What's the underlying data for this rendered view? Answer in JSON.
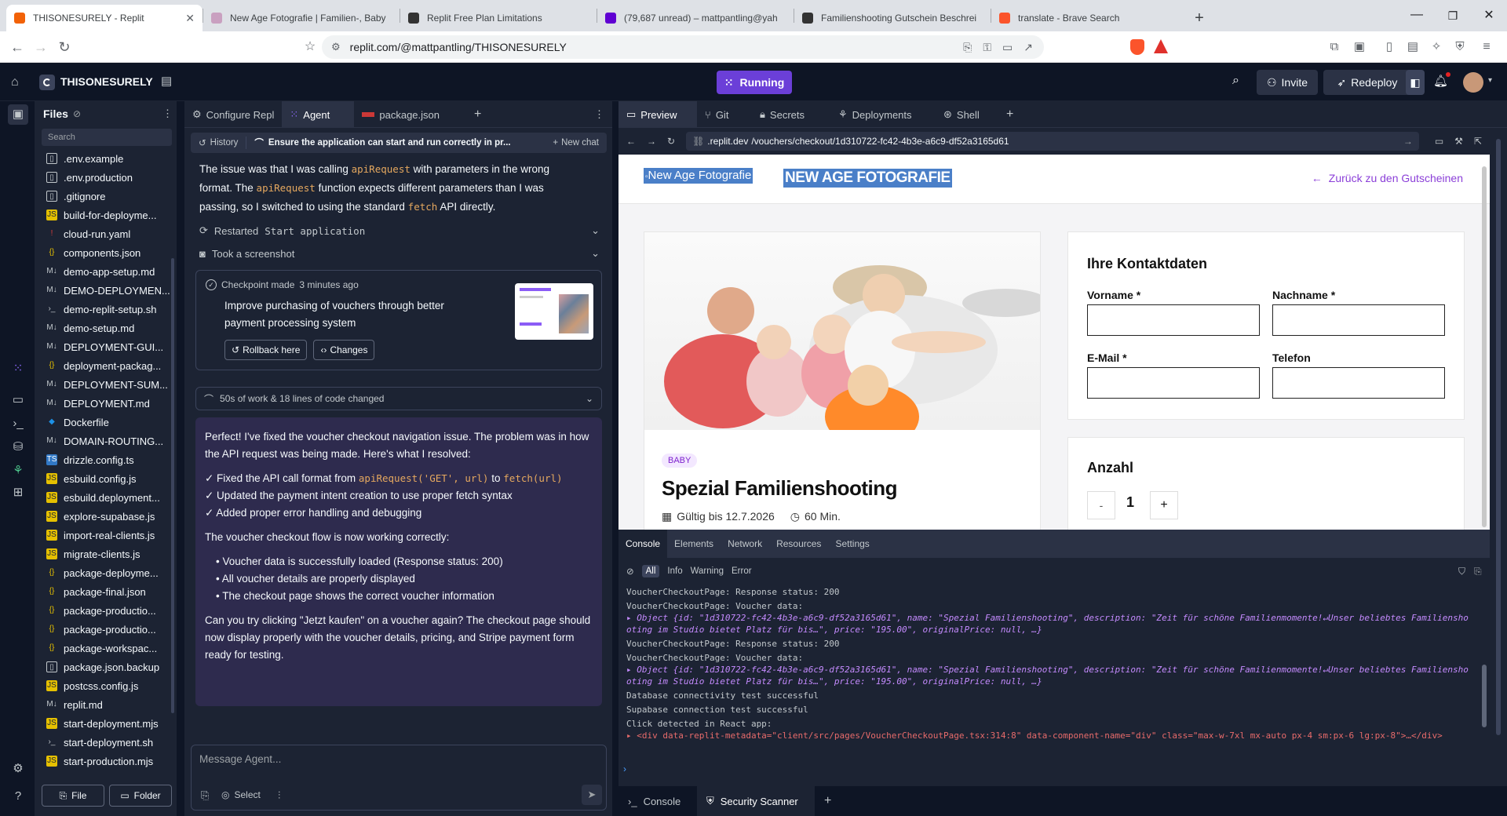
{
  "browser": {
    "tabs": [
      {
        "title": "THISONESURELY - Replit",
        "color": "#f26207",
        "active": true
      },
      {
        "title": "New Age Fotografie | Familien-, Baby",
        "color": "#c9a0c0",
        "active": false
      },
      {
        "title": "Replit Free Plan Limitations",
        "color": "#333333",
        "active": false
      },
      {
        "title": "(79,687 unread) – mattpantling@yah",
        "color": "#6001d2",
        "active": false
      },
      {
        "title": "Familienshooting Gutschein Beschrei",
        "color": "#333333",
        "active": false
      },
      {
        "title": "translate - Brave Search",
        "color": "#fb542b",
        "active": false
      }
    ],
    "url": "replit.com/@mattpantling/THISONESURELY"
  },
  "replit": {
    "project_name": "THISONESURELY",
    "run_label": "Running",
    "invite_label": "Invite",
    "redeploy_label": "Redeploy"
  },
  "files": {
    "title": "Files",
    "search_placeholder": "Search",
    "items": [
      {
        "name": ".env.example",
        "type": "doc"
      },
      {
        "name": ".env.production",
        "type": "doc"
      },
      {
        "name": ".gitignore",
        "type": "doc"
      },
      {
        "name": "build-for-deployme...",
        "type": "js"
      },
      {
        "name": "cloud-run.yaml",
        "type": "yaml"
      },
      {
        "name": "components.json",
        "type": "json"
      },
      {
        "name": "demo-app-setup.md",
        "type": "md"
      },
      {
        "name": "DEMO-DEPLOYMEN...",
        "type": "md"
      },
      {
        "name": "demo-replit-setup.sh",
        "type": "sh"
      },
      {
        "name": "demo-setup.md",
        "type": "md"
      },
      {
        "name": "DEPLOYMENT-GUI...",
        "type": "md"
      },
      {
        "name": "deployment-packag...",
        "type": "json"
      },
      {
        "name": "DEPLOYMENT-SUM...",
        "type": "md"
      },
      {
        "name": "DEPLOYMENT.md",
        "type": "md"
      },
      {
        "name": "Dockerfile",
        "type": "docker"
      },
      {
        "name": "DOMAIN-ROUTING...",
        "type": "md"
      },
      {
        "name": "drizzle.config.ts",
        "type": "ts"
      },
      {
        "name": "esbuild.config.js",
        "type": "js"
      },
      {
        "name": "esbuild.deployment...",
        "type": "js"
      },
      {
        "name": "explore-supabase.js",
        "type": "js"
      },
      {
        "name": "import-real-clients.js",
        "type": "js"
      },
      {
        "name": "migrate-clients.js",
        "type": "js"
      },
      {
        "name": "package-deployme...",
        "type": "json"
      },
      {
        "name": "package-final.json",
        "type": "json"
      },
      {
        "name": "package-productio...",
        "type": "json"
      },
      {
        "name": "package-productio...",
        "type": "json"
      },
      {
        "name": "package-workspac...",
        "type": "json"
      },
      {
        "name": "package.json.backup",
        "type": "doc"
      },
      {
        "name": "postcss.config.js",
        "type": "js"
      },
      {
        "name": "replit.md",
        "type": "md"
      },
      {
        "name": "start-deployment.mjs",
        "type": "js"
      },
      {
        "name": "start-deployment.sh",
        "type": "sh"
      },
      {
        "name": "start-production.mjs",
        "type": "js"
      }
    ],
    "file_btn": "File",
    "folder_btn": "Folder"
  },
  "agent": {
    "tabs": [
      "Configure Repl",
      "Agent",
      "package.json"
    ],
    "history_label": "History",
    "thread_title": "Ensure the application can start and run correctly in pr...",
    "new_chat_label": "New chat",
    "top_text_1": "The issue was that I was calling",
    "top_code_1": "apiRequest",
    "top_text_2": "with parameters in the wrong",
    "top_text_3": "format. The",
    "top_code_2": "apiRequest",
    "top_text_4": "function expects different parameters than I was",
    "top_text_5": "passing, so I switched to using the standard",
    "top_code_3": "fetch",
    "top_text_6": "API directly.",
    "restarted_label": "Restarted",
    "restarted_code": "Start application",
    "screenshot_label": "Took a screenshot",
    "checkpoint_title": "Checkpoint made",
    "checkpoint_time": "3 minutes ago",
    "checkpoint_desc": "Improve purchasing of vouchers through better payment processing system",
    "rollback_label": "Rollback here",
    "changes_label": "Changes",
    "work_summary": "50s of work & 18 lines of code changed",
    "msg": {
      "p1": "Perfect! I've fixed the voucher checkout navigation issue. The problem was in how the API request was being made. Here's what I resolved:",
      "c1_a": "✓ Fixed the API call format from",
      "c1_code1": "apiRequest('GET', url)",
      "c1_b": "to",
      "c1_code2": "fetch(url)",
      "c2": "✓ Updated the payment intent creation to use proper fetch syntax",
      "c3": "✓ Added proper error handling and debugging",
      "p2": "The voucher checkout flow is now working correctly:",
      "b1": "Voucher data is successfully loaded (Response status: 200)",
      "b2": "All voucher details are properly displayed",
      "b3": "The checkout page shows the correct voucher information",
      "p3": "Can you try clicking \"Jetzt kaufen\" on a voucher again? The checkout page should now display properly with the voucher details, pricing, and Stripe payment form ready for testing."
    },
    "input_placeholder": "Message Agent...",
    "select_label": "Select"
  },
  "preview": {
    "tabs": [
      "Preview",
      "Git",
      "Secrets",
      "Deployments",
      "Shell"
    ],
    "url_host": ".replit.dev",
    "url_path": "/vouchers/checkout/1d310722-fc42-4b3e-a6c9-df52a3165d61",
    "site": {
      "logo_alt": "New Age Fotografie",
      "brand": "NEW AGE FOTOGRAFIE",
      "back_link": "Zurück zu den Gutscheinen",
      "badge": "BABY",
      "product_title": "Spezial Familienshooting",
      "valid_until": "Gültig bis 12.7.2026",
      "duration": "60 Min.",
      "contact_title": "Ihre Kontaktdaten",
      "first_name": "Vorname *",
      "last_name": "Nachname *",
      "email": "E-Mail *",
      "phone": "Telefon",
      "qty_title": "Anzahl",
      "qty_minus": "-",
      "qty_value": "1",
      "qty_plus": "+"
    }
  },
  "devtools": {
    "tabs": [
      "Console",
      "Elements",
      "Network",
      "Resources",
      "Settings"
    ],
    "filters": [
      "All",
      "Info",
      "Warning",
      "Error"
    ],
    "logs": [
      {
        "text": "VoucherCheckoutPage: Response status: 200"
      },
      {
        "text": "VoucherCheckoutPage: Voucher data:"
      },
      {
        "text": "▸ Object {id: \"1d310722-fc42-4b3e-a6c9-df52a3165d61\", name: \"Spezial Familienshooting\", description: \"Zeit für schöne Familienmomente!↵Unser beliebtes Familiensho",
        "obj": true
      },
      {
        "text": "  oting im Studio bietet Platz für bis…\", price: \"195.00\", originalPrice: null, …}",
        "obj": true
      },
      {
        "text": "VoucherCheckoutPage: Response status: 200"
      },
      {
        "text": "VoucherCheckoutPage: Voucher data:"
      },
      {
        "text": "▸ Object {id: \"1d310722-fc42-4b3e-a6c9-df52a3165d61\", name: \"Spezial Familienshooting\", description: \"Zeit für schöne Familienmomente!↵Unser beliebtes Familiensho",
        "obj": true
      },
      {
        "text": "  oting im Studio bietet Platz für bis…\", price: \"195.00\", originalPrice: null, …}",
        "obj": true
      },
      {
        "text": "Database connectivity test successful"
      },
      {
        "text": "Supabase connection test successful"
      },
      {
        "text": "Click detected in React app:"
      },
      {
        "text": "▸ <div data-replit-metadata=\"client/src/pages/VoucherCheckoutPage.tsx:314:8\" data-component-name=\"div\" class=\"max-w-7xl mx-auto px-4 sm:px-6 lg:px-8\">…</div>",
        "html": true
      }
    ],
    "bottom_tabs": [
      "Console",
      "Security Scanner"
    ]
  }
}
